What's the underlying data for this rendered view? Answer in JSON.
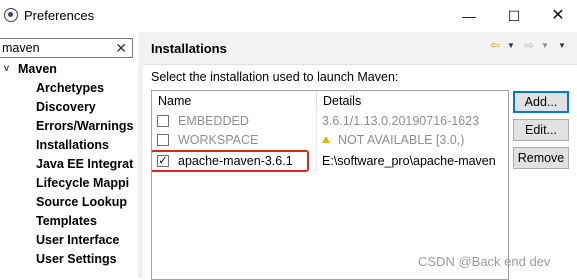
{
  "window": {
    "title": "Preferences",
    "min_label": "—",
    "max_label": "☐",
    "close_label": "✕"
  },
  "filter": {
    "value": "maven",
    "clear": "✕"
  },
  "tree": {
    "root": {
      "label": "Maven",
      "chevron": "v"
    },
    "items": [
      "Archetypes",
      "Discovery",
      "Errors/Warnings",
      "Installations",
      "Java EE Integrat",
      "Lifecycle Mappi",
      "Source Lookup",
      "Templates",
      "User Interface",
      "User Settings"
    ]
  },
  "page": {
    "title": "Installations",
    "instructions": "Select the installation used to launch Maven:"
  },
  "table": {
    "columns": [
      "Name",
      "Details"
    ],
    "rows": [
      {
        "name": "EMBEDDED",
        "details": "3.6.1/1.13.0.20190716-1623",
        "checked": false,
        "enabled": false,
        "warning": false
      },
      {
        "name": "WORKSPACE",
        "details": "NOT AVAILABLE [3.0,)",
        "checked": false,
        "enabled": false,
        "warning": true
      },
      {
        "name": "apache-maven-3.6.1",
        "details": "E:\\software_pro\\apache-maven",
        "checked": true,
        "enabled": true,
        "warning": false
      }
    ]
  },
  "buttons": {
    "add": "Add...",
    "edit": "Edit...",
    "remove": "Remove"
  },
  "watermark": "CSDN @Back end dev",
  "colors": {
    "highlight": "#e0251b",
    "header_bg": "#f3f3f3",
    "disabled_text": "#8d8d8d",
    "default_button_border": "#0078d7"
  }
}
